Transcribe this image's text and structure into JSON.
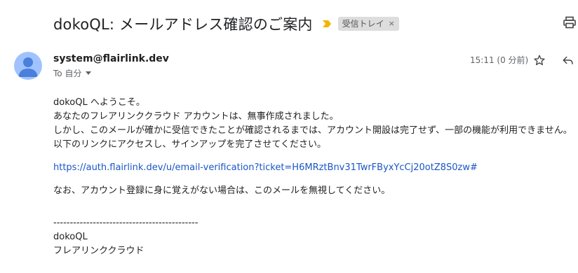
{
  "email": {
    "subject": "dokoQL: メールアドレス確認のご案内",
    "label": "受信トレイ",
    "label_remove": "×",
    "sender": "system@flairlink.dev",
    "to_me": "To 自分",
    "timestamp": "15:11 (0 分前)"
  },
  "body": {
    "greeting": "dokoQL へようこそ。",
    "line1": "あなたのフレアリンククラウド アカウントは、無事作成されました。",
    "line2": "しかし、このメールが確かに受信できたことが確認されるまでは、アカウント開設は完了せず、一部の機能が利用できません。",
    "line3": "以下のリンクにアクセスし、サインアップを完了させてください。",
    "link": "https://auth.flairlink.dev/u/email-verification?ticket=H6MRztBnv31TwrFByxYcCj20otZ8S0zw#",
    "note": "なお、アカウント登録に身に覚えがない場合は、このメールを無視してください。",
    "separator": "--------------------------------------------",
    "signature_name": "dokoQL",
    "signature_company": "フレアリンククラウド"
  },
  "icons": {
    "importance": "importance-marker-icon",
    "print": "print-icon",
    "avatar": "person-avatar-icon",
    "star": "star-icon",
    "reply": "reply-icon",
    "caret": "caret-down-icon"
  },
  "colors": {
    "importance": "#f2b600",
    "avatar_bg": "#a0c3ff",
    "avatar_fg": "#4a7fdc",
    "link": "#1a56c6",
    "chip_bg": "#dddddd"
  }
}
